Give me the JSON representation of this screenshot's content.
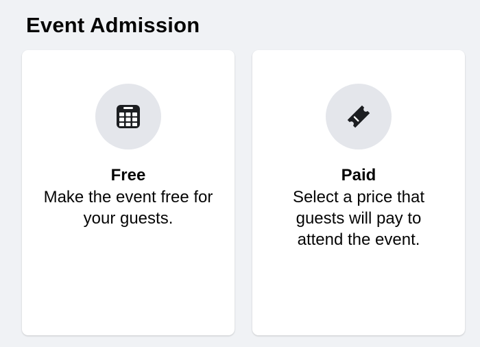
{
  "header": {
    "title": "Event Admission"
  },
  "options": [
    {
      "title": "Free",
      "description": "Make the event free for your guests.",
      "icon": "calendar-icon"
    },
    {
      "title": "Paid",
      "description": "Select a price that guests will pay to attend the event.",
      "icon": "ticket-icon"
    }
  ],
  "colors": {
    "background": "#f0f2f5",
    "card": "#ffffff",
    "icon_circle": "#e4e6eb",
    "text": "#050505"
  }
}
